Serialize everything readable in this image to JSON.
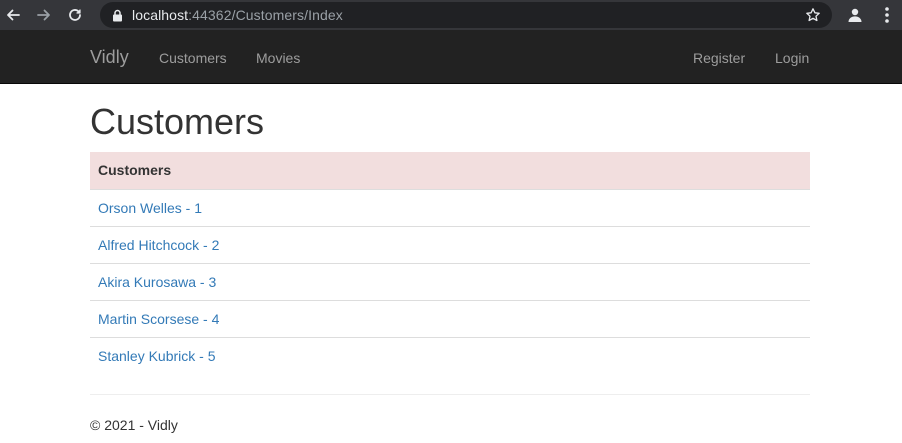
{
  "browser": {
    "url_host": "localhost",
    "url_rest": ":44362/Customers/Index",
    "icons": {
      "back": "back-arrow-icon",
      "forward": "forward-arrow-icon",
      "reload": "reload-icon",
      "lock": "lock-icon",
      "star": "star-icon",
      "profile": "profile-icon",
      "menu": "kebab-menu-icon"
    }
  },
  "navbar": {
    "brand": "Vidly",
    "links": [
      {
        "label": "Customers"
      },
      {
        "label": "Movies"
      }
    ],
    "right_links": [
      {
        "label": "Register"
      },
      {
        "label": "Login"
      }
    ]
  },
  "main": {
    "title": "Customers",
    "table": {
      "header": "Customers",
      "rows": [
        {
          "name": "Orson Welles - 1"
        },
        {
          "name": "Alfred Hitchcock - 2"
        },
        {
          "name": "Akira Kurosawa - 3"
        },
        {
          "name": "Martin Scorsese - 4"
        },
        {
          "name": "Stanley Kubrick - 5"
        }
      ]
    }
  },
  "footer": {
    "text": "© 2021 - Vidly"
  },
  "colors": {
    "navbar_bg": "#222222",
    "header_bg": "#f2dede",
    "link": "#337ab7"
  }
}
